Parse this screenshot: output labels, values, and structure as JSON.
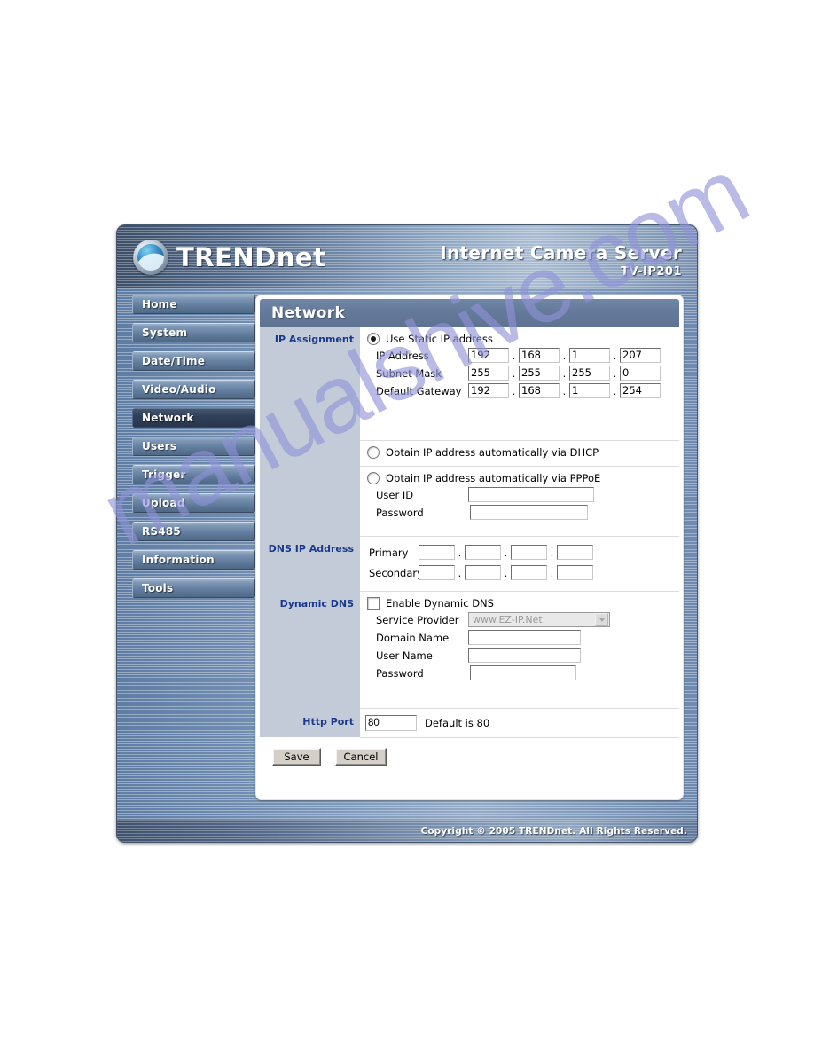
{
  "brand": {
    "name_upper": "TREND",
    "name_lower": "net",
    "logo_icon": "trendnet-globe-icon"
  },
  "header": {
    "product_name": "Internet Camera Server",
    "model": "TV-IP201"
  },
  "sidebar": {
    "items": [
      {
        "label": "Home",
        "active": false
      },
      {
        "label": "System",
        "active": false
      },
      {
        "label": "Date/Time",
        "active": false
      },
      {
        "label": "Video/Audio",
        "active": false
      },
      {
        "label": "Network",
        "active": true
      },
      {
        "label": "Users",
        "active": false
      },
      {
        "label": "Trigger",
        "active": false
      },
      {
        "label": "Upload",
        "active": false
      },
      {
        "label": "RS485",
        "active": false
      },
      {
        "label": "Information",
        "active": false
      },
      {
        "label": "Tools",
        "active": false
      }
    ]
  },
  "panel": {
    "title": "Network"
  },
  "ip_assignment": {
    "section_label": "IP Assignment",
    "static_option": "Use Static IP address",
    "static_selected": true,
    "ip_address_label": "IP Address",
    "ip_address": [
      "192",
      "168",
      "1",
      "207"
    ],
    "subnet_mask_label": "Subnet Mask",
    "subnet_mask": [
      "255",
      "255",
      "255",
      "0"
    ],
    "default_gateway_label": "Default Gateway",
    "default_gateway": [
      "192",
      "168",
      "1",
      "254"
    ],
    "dhcp_option": "Obtain IP address automatically via DHCP",
    "dhcp_selected": false,
    "pppoe_option": "Obtain IP address automatically via PPPoE",
    "pppoe_selected": false,
    "user_id_label": "User ID",
    "user_id_value": "",
    "password_label": "Password",
    "password_value": ""
  },
  "dns": {
    "section_label": "DNS IP Address",
    "primary_label": "Primary",
    "primary": [
      "",
      "",
      "",
      ""
    ],
    "secondary_label": "Secondary",
    "secondary": [
      "",
      "",
      "",
      ""
    ]
  },
  "dynamic_dns": {
    "section_label": "Dynamic DNS",
    "enable_label": "Enable Dynamic DNS",
    "enabled": false,
    "service_provider_label": "Service Provider",
    "service_provider_value": "www.EZ-IP.Net",
    "domain_name_label": "Domain Name",
    "domain_name_value": "",
    "user_name_label": "User Name",
    "user_name_value": "",
    "password_label": "Password",
    "password_value": ""
  },
  "http_port": {
    "section_label": "Http Port",
    "value": "80",
    "hint": "Default is 80"
  },
  "actions": {
    "save_label": "Save",
    "cancel_label": "Cancel"
  },
  "footer": {
    "copyright": "Copyright © 2005 TRENDnet. All Rights Reserved."
  },
  "watermark": {
    "text": "manualshive.com",
    "color": "#8f93d8"
  },
  "colors": {
    "panel_title_bg": "#65799a",
    "label_column_bg": "#c3cbd9",
    "label_text": "#1b3a8c",
    "nav_active_bg": "#31405a"
  }
}
